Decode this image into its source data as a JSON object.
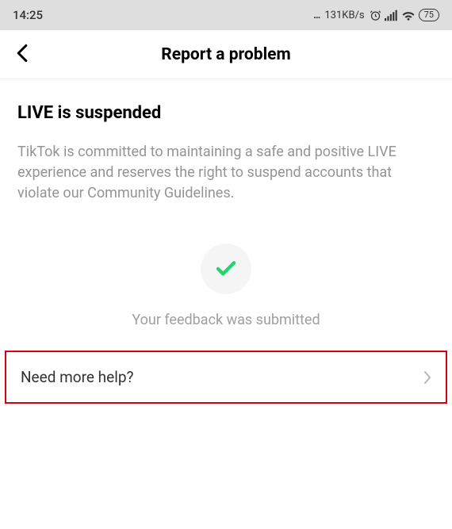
{
  "status_bar": {
    "time": "14:25",
    "network_speed": "131KB/s",
    "battery": "75"
  },
  "header": {
    "title": "Report a problem"
  },
  "main": {
    "heading": "LIVE is suspended",
    "body": "TikTok is committed to maintaining a safe and positive LIVE experience and reserves the right to suspend accounts that violate our Community Guidelines.",
    "feedback_text": "Your feedback was submitted"
  },
  "help": {
    "label": "Need more help?"
  }
}
